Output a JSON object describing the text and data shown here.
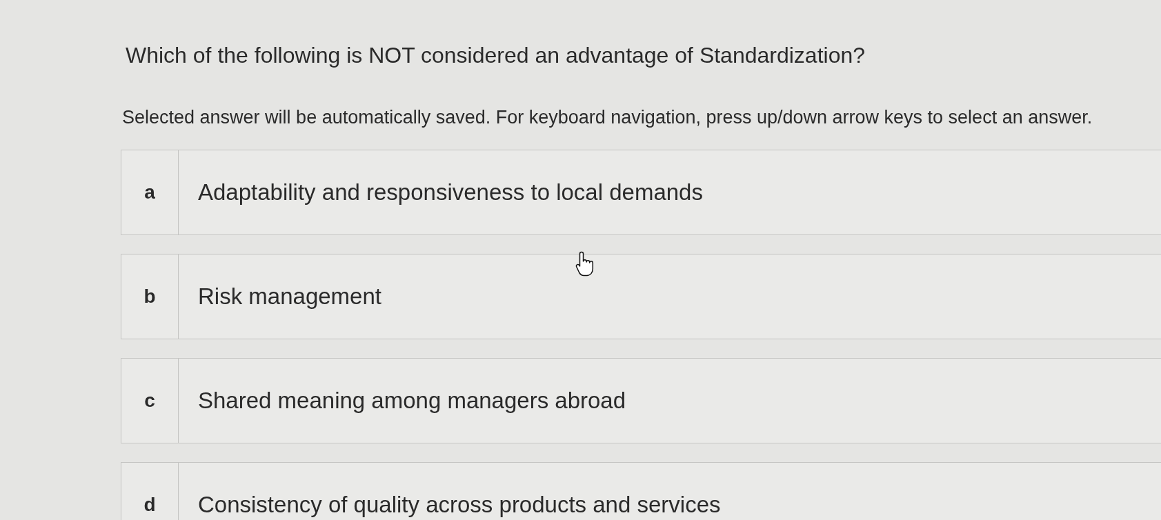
{
  "question": "Which of the following is NOT considered an advantage of Standardization?",
  "instructions": "Selected answer will be automatically saved. For keyboard navigation, press up/down arrow keys to select an answer.",
  "options": [
    {
      "letter": "a",
      "text": "Adaptability and responsiveness to local demands",
      "selected": false
    },
    {
      "letter": "b",
      "text": "Risk management",
      "selected": false
    },
    {
      "letter": "c",
      "text": "Shared meaning among managers abroad",
      "selected": false
    },
    {
      "letter": "d",
      "text": "Consistency of quality across products and services",
      "selected": false
    }
  ]
}
